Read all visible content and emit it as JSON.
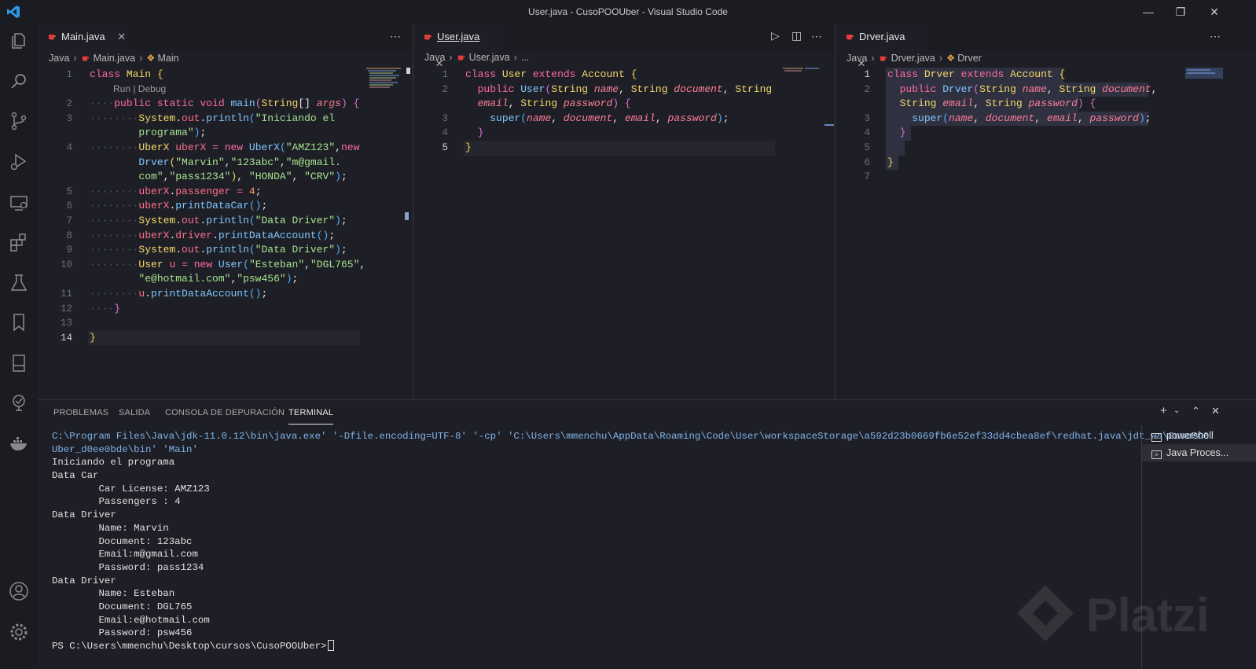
{
  "window": {
    "title": "User.java - CusoPOOUber - Visual Studio Code"
  },
  "activity_icons": [
    "explorer-icon",
    "search-icon",
    "source-control-icon",
    "run-debug-icon",
    "remote-explorer-icon",
    "extensions-icon",
    "testing-icon",
    "bookmarks-icon",
    "notebook-icon",
    "timeline-icon",
    "docker-icon",
    "account-icon",
    "settings-gear-icon"
  ],
  "editors": {
    "left": {
      "tab": "Main.java",
      "breadcrumb": [
        "Java",
        "Main.java",
        "Main"
      ],
      "codelens": "Run | Debug",
      "line_numbers": [
        "1",
        "2",
        "3",
        "4",
        "5",
        "6",
        "7",
        "8",
        "9",
        "10",
        "11",
        "12",
        "13",
        "14"
      ]
    },
    "middle": {
      "tab": "User.java",
      "breadcrumb": [
        "Java",
        "User.java",
        "..."
      ],
      "line_numbers": [
        "1",
        "2",
        "3",
        "4",
        "5"
      ]
    },
    "right": {
      "tab": "Drver.java",
      "breadcrumb": [
        "Java",
        "Drver.java",
        "Drver"
      ],
      "line_numbers": [
        "1",
        "2",
        "3",
        "4",
        "5",
        "6",
        "7"
      ]
    }
  },
  "code": {
    "main": [
      "class Main {",
      "public static void main(String[] args) {",
      "System.out.println(\"Iniciando el",
      "programa\");",
      "UberX uberX = new UberX(\"AMZ123\",new",
      "Drver(\"Marvin\",\"123abc\",\"m@gmail.",
      "com\",\"pass1234\"), \"HONDA\", \"CRV\");",
      "uberX.passenger = 4;",
      "uberX.printDataCar();",
      "System.out.println(\"Data Driver\");",
      "uberX.driver.printDataAccount();",
      "System.out.println(\"Data Driver\");",
      "User u = new User(\"Esteban\",\"DGL765\",",
      "\"e@hotmail.com\",\"psw456\");",
      "u.printDataAccount();",
      "}",
      "}"
    ],
    "user": [
      "class User extends Account {",
      "public User(String name, String document, String",
      "email, String password) {",
      "super(name, document, email, password);",
      "}",
      "}"
    ],
    "drver": [
      "class Drver extends Account {",
      "public Drver(String name, String document,",
      "String email, String password) {",
      "super(name, document, email, password);",
      "}",
      "}"
    ]
  },
  "panel": {
    "tabs": [
      "PROBLEMAS",
      "SALIDA",
      "CONSOLA DE DEPURACIÓN",
      "TERMINAL"
    ],
    "active_tab": "TERMINAL",
    "terminal_lines": [
      "C:\\Program Files\\Java\\jdk-11.0.12\\bin\\java.exe' '-Dfile.encoding=UTF-8' '-cp' 'C:\\Users\\mmenchu\\AppData\\Roaming\\Code\\User\\workspaceStorage\\a592d23b0669fb6e52ef33dd4cbea8ef\\redhat.java\\jdt_ws\\CusoPOO",
      "Uber_d0ee0bde\\bin' 'Main'",
      "Iniciando el programa",
      "Data Car",
      "        Car License: AMZ123",
      "        Passengers : 4",
      "Data Driver",
      "        Name: Marvin",
      "        Document: 123abc",
      "        Email:m@gmail.com",
      "        Password: pass1234",
      "Data Driver",
      "        Name: Esteban",
      "        Document: DGL765",
      "        Email:e@hotmail.com",
      "        Password: psw456"
    ],
    "prompt": "PS C:\\Users\\mmenchu\\Desktop\\cursos\\CusoPOOUber>",
    "terminals": [
      "powershell",
      "Java Proces..."
    ]
  },
  "watermark": "Platzi",
  "colors": {
    "background": "#1e1f26",
    "keyword": "#ff6aa2",
    "function": "#7ec7ff",
    "type": "#f6d86a",
    "string": "#a5e38f",
    "terminal_command": "#7fb3ea"
  }
}
